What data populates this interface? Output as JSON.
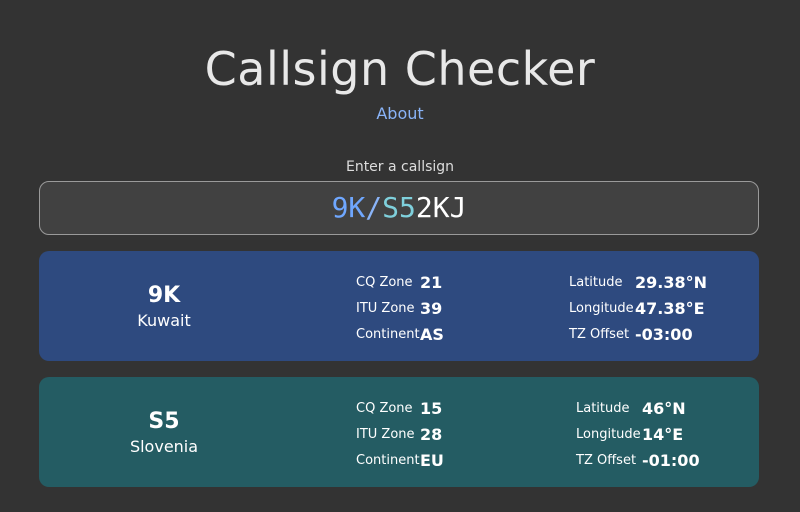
{
  "header": {
    "title": "Callsign Checker",
    "about_link": "About"
  },
  "search": {
    "prompt": "Enter a callsign",
    "value_segments": {
      "prefix1": "9K",
      "separator": "/",
      "prefix2": "S5",
      "rest": "2KJ"
    }
  },
  "labels": {
    "cq_zone": "CQ Zone",
    "itu_zone": "ITU Zone",
    "continent": "Continent",
    "latitude": "Latitude",
    "longitude": "Longitude",
    "tz_offset": "TZ Offset"
  },
  "results": [
    {
      "prefix": "9K",
      "country": "Kuwait",
      "cq_zone": "21",
      "itu_zone": "39",
      "continent": "AS",
      "latitude": "29.38°N",
      "longitude": "47.38°E",
      "tz_offset": "-03:00",
      "color": "#2e4a7f"
    },
    {
      "prefix": "S5",
      "country": "Slovenia",
      "cq_zone": "15",
      "itu_zone": "28",
      "continent": "EU",
      "latitude": "46°N",
      "longitude": "14°E",
      "tz_offset": "-01:00",
      "color": "#245c63"
    }
  ],
  "colors": {
    "background": "#333333",
    "link": "#8ab4f8",
    "prefix1": "#6fa7ff",
    "prefix2": "#7fd0dc"
  }
}
